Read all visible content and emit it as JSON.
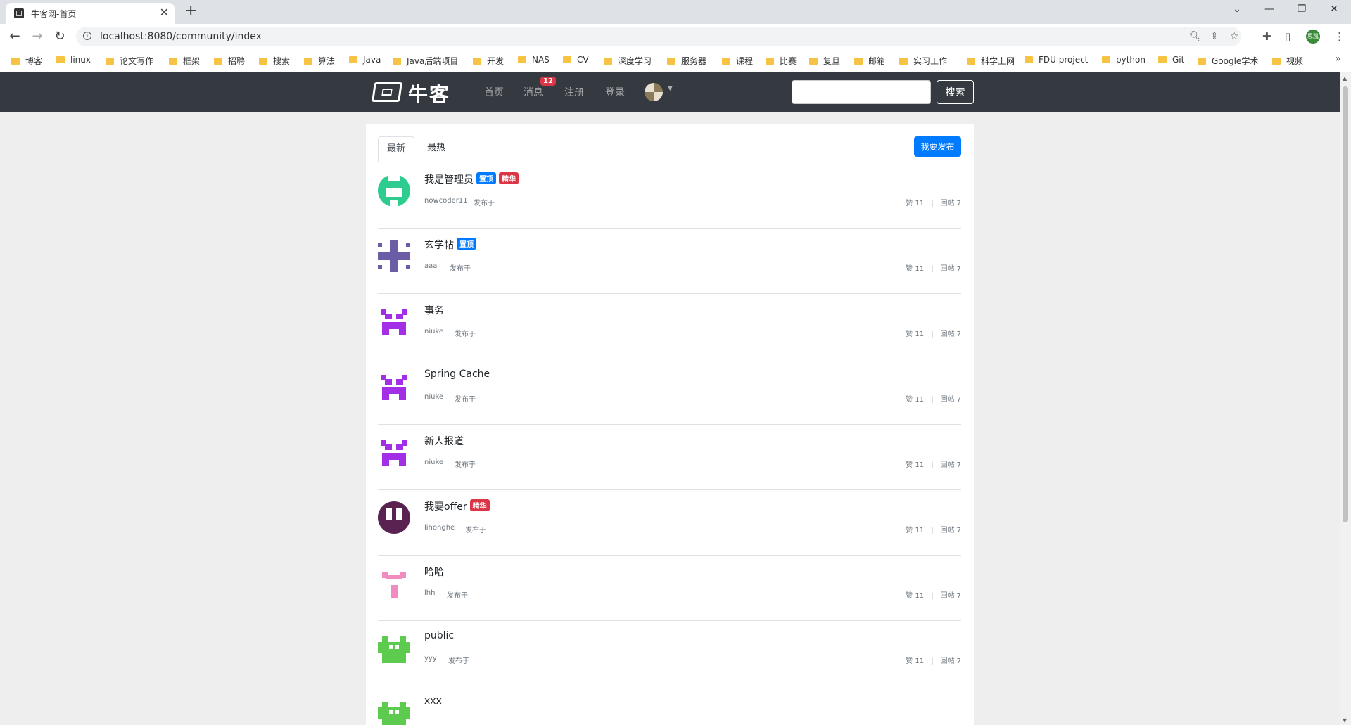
{
  "browser": {
    "tab_title": "牛客网-首页",
    "url": "localhost:8080/community/index",
    "profile_label": "思凯",
    "bookmarks": [
      "博客",
      "linux",
      "论文写作",
      "框架",
      "招聘",
      "搜索",
      "算法",
      "Java",
      "Java后端项目",
      "开发",
      "NAS",
      "CV",
      "深度学习",
      "服务器",
      "课程",
      "比赛",
      "复旦",
      "邮箱",
      "实习工作",
      "科学上网",
      "FDU project",
      "python",
      "Git",
      "Google学术",
      "视频"
    ]
  },
  "navbar": {
    "logo_text": "牛客",
    "links": {
      "home": "首页",
      "messages": "消息",
      "register": "注册",
      "login": "登录"
    },
    "message_count": "12",
    "search_placeholder": "",
    "search_button": "搜索"
  },
  "main": {
    "tabs": {
      "latest": "最新",
      "hottest": "最热"
    },
    "publish_button": "我要发布",
    "badges": {
      "top": "置顶",
      "wonderful": "精华"
    },
    "posts": [
      {
        "title": "我是管理员",
        "author": "nowcoder11",
        "time": "发布于",
        "likes": "赞 11",
        "replies": "回帖 7",
        "avatar_color": "#2ecc8f"
      },
      {
        "title": "玄学帖",
        "author": "aaa",
        "time": "发布于",
        "likes": "赞 11",
        "replies": "回帖 7",
        "avatar_color": "#6b5ca5"
      },
      {
        "title": "事务",
        "author": "niuke",
        "time": "发布于",
        "likes": "赞 11",
        "replies": "回帖 7",
        "avatar_color": "#a32ee8"
      },
      {
        "title": "Spring Cache",
        "author": "niuke",
        "time": "发布于",
        "likes": "赞 11",
        "replies": "回帖 7",
        "avatar_color": "#a32ee8"
      },
      {
        "title": "新人报道",
        "author": "niuke",
        "time": "发布于",
        "likes": "赞 11",
        "replies": "回帖 7",
        "avatar_color": "#a32ee8"
      },
      {
        "title": "我要offer",
        "author": "lihonghe",
        "time": "发布于",
        "likes": "赞 11",
        "replies": "回帖 7",
        "avatar_color": "#5a2251"
      },
      {
        "title": "哈哈",
        "author": "lhh",
        "time": "发布于",
        "likes": "赞 11",
        "replies": "回帖 7",
        "avatar_color": "#f08cc0"
      },
      {
        "title": "public",
        "author": "yyy",
        "time": "发布于",
        "likes": "赞 11",
        "replies": "回帖 7",
        "avatar_color": "#5ccb4e"
      },
      {
        "title": "xxx",
        "author": "",
        "time": "",
        "likes": "",
        "replies": "",
        "avatar_color": "#5ccb4e"
      }
    ]
  }
}
